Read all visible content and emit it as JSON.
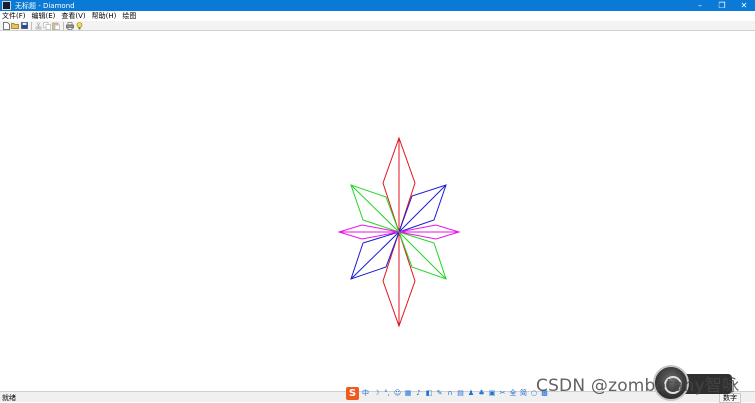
{
  "window": {
    "title": "无标题 - Diamond",
    "controls": [
      "–",
      "❐",
      "✕"
    ]
  },
  "menu": [
    "文件(F)",
    "编辑(E)",
    "查看(V)",
    "帮助(H)",
    "绘图"
  ],
  "toolbar": {
    "buttons": [
      "new-icon",
      "open-icon",
      "save-icon",
      "cut-icon",
      "copy-icon",
      "paste-icon",
      "print-icon",
      "help-icon"
    ]
  },
  "drawing": {
    "stroke_colors": {
      "vertical": "#e0141e",
      "main_diagonal": "#1a1ad6",
      "anti_diagonal": "#22d622",
      "horizontal": "#e614e6"
    }
  },
  "status": {
    "left": "就绪",
    "right": "数字"
  },
  "ime": {
    "logo": "S",
    "mode": "中"
  },
  "watermark": "CSDN @zombotany智咏"
}
